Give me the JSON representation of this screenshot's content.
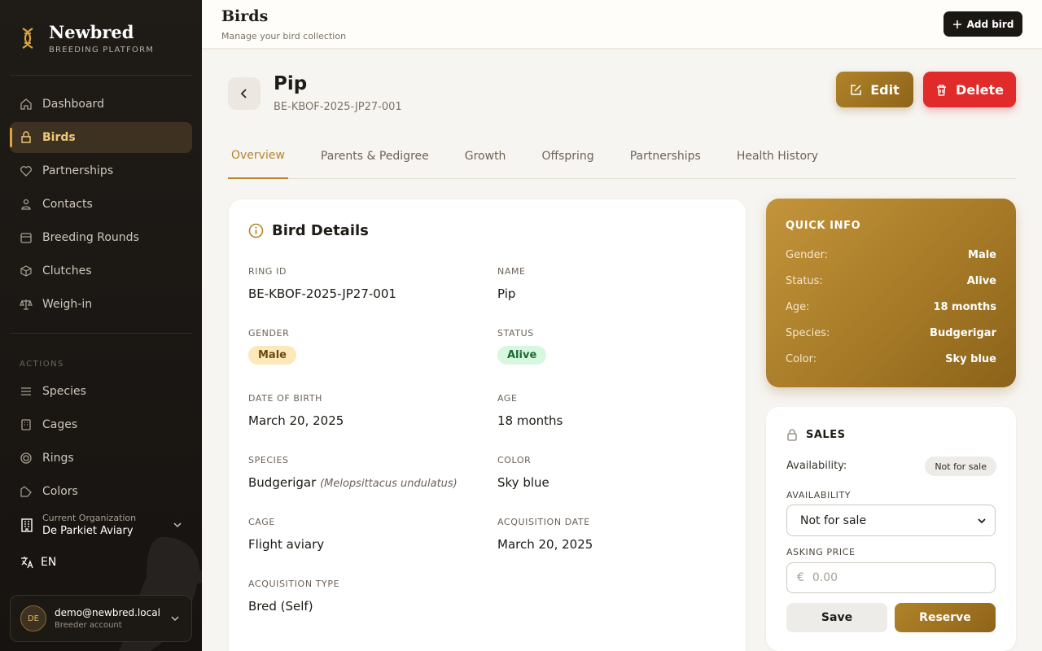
{
  "brand": {
    "title": "Newbred",
    "subtitle": "BREEDING PLATFORM"
  },
  "nav": {
    "items": [
      {
        "label": "Dashboard",
        "icon": "home-icon"
      },
      {
        "label": "Birds",
        "icon": "bird-icon"
      },
      {
        "label": "Partnerships",
        "icon": "heart-icon"
      },
      {
        "label": "Contacts",
        "icon": "users-icon"
      },
      {
        "label": "Breeding Rounds",
        "icon": "calendar-icon"
      },
      {
        "label": "Clutches",
        "icon": "box-icon"
      },
      {
        "label": "Weigh-in",
        "icon": "scale-icon"
      }
    ],
    "section_label": "ACTIONS",
    "actions": [
      {
        "label": "Species",
        "icon": "list-icon"
      },
      {
        "label": "Cages",
        "icon": "grid-icon"
      },
      {
        "label": "Rings",
        "icon": "ring-icon"
      },
      {
        "label": "Colors",
        "icon": "palette-icon"
      }
    ]
  },
  "org": {
    "label": "Current Organization",
    "name": "De Parkiet Aviary"
  },
  "lang": "EN",
  "user": {
    "initials": "DE",
    "email": "demo@newbred.local",
    "role": "Breeder account"
  },
  "topbar": {
    "title": "Birds",
    "subtitle": "Manage your bird collection",
    "add_label": "Add bird"
  },
  "bird": {
    "name": "Pip",
    "ring": "BE-KBOF-2025-JP27-001"
  },
  "actions": {
    "edit": "Edit",
    "delete": "Delete"
  },
  "tabs": [
    "Overview",
    "Parents & Pedigree",
    "Growth",
    "Offspring",
    "Partnerships",
    "Health History"
  ],
  "details": {
    "title": "Bird Details",
    "ring_id": {
      "label": "RING ID",
      "value": "BE-KBOF-2025-JP27-001"
    },
    "name": {
      "label": "NAME",
      "value": "Pip"
    },
    "gender": {
      "label": "GENDER",
      "value": "Male"
    },
    "status": {
      "label": "STATUS",
      "value": "Alive"
    },
    "dob": {
      "label": "DATE OF BIRTH",
      "value": "March 20, 2025"
    },
    "age": {
      "label": "AGE",
      "value": "18 months"
    },
    "species": {
      "label": "SPECIES",
      "value": "Budgerigar",
      "latin": "(Melopsittacus undulatus)"
    },
    "color": {
      "label": "COLOR",
      "value": "Sky blue"
    },
    "cage": {
      "label": "CAGE",
      "value": "Flight aviary"
    },
    "acq_date": {
      "label": "ACQUISITION DATE",
      "value": "March 20, 2025"
    },
    "acq_type": {
      "label": "ACQUISITION TYPE",
      "value": "Bred (Self)"
    }
  },
  "quick": {
    "title": "QUICK INFO",
    "rows": [
      {
        "k": "Gender:",
        "v": "Male"
      },
      {
        "k": "Status:",
        "v": "Alive"
      },
      {
        "k": "Age:",
        "v": "18 months"
      },
      {
        "k": "Species:",
        "v": "Budgerigar"
      },
      {
        "k": "Color:",
        "v": "Sky blue"
      }
    ]
  },
  "sales": {
    "title": "SALES",
    "availability_text": "Availability:",
    "badge": "Not for sale",
    "availability_label": "AVAILABILITY",
    "availability_value": "Not for sale",
    "price_label": "ASKING PRICE",
    "currency": "€",
    "price_placeholder": "0.00",
    "save": "Save",
    "reserve": "Reserve"
  },
  "colors": {
    "accent": "#b5842c",
    "danger": "#e12b2b",
    "sidebar": "#1f1b17"
  }
}
